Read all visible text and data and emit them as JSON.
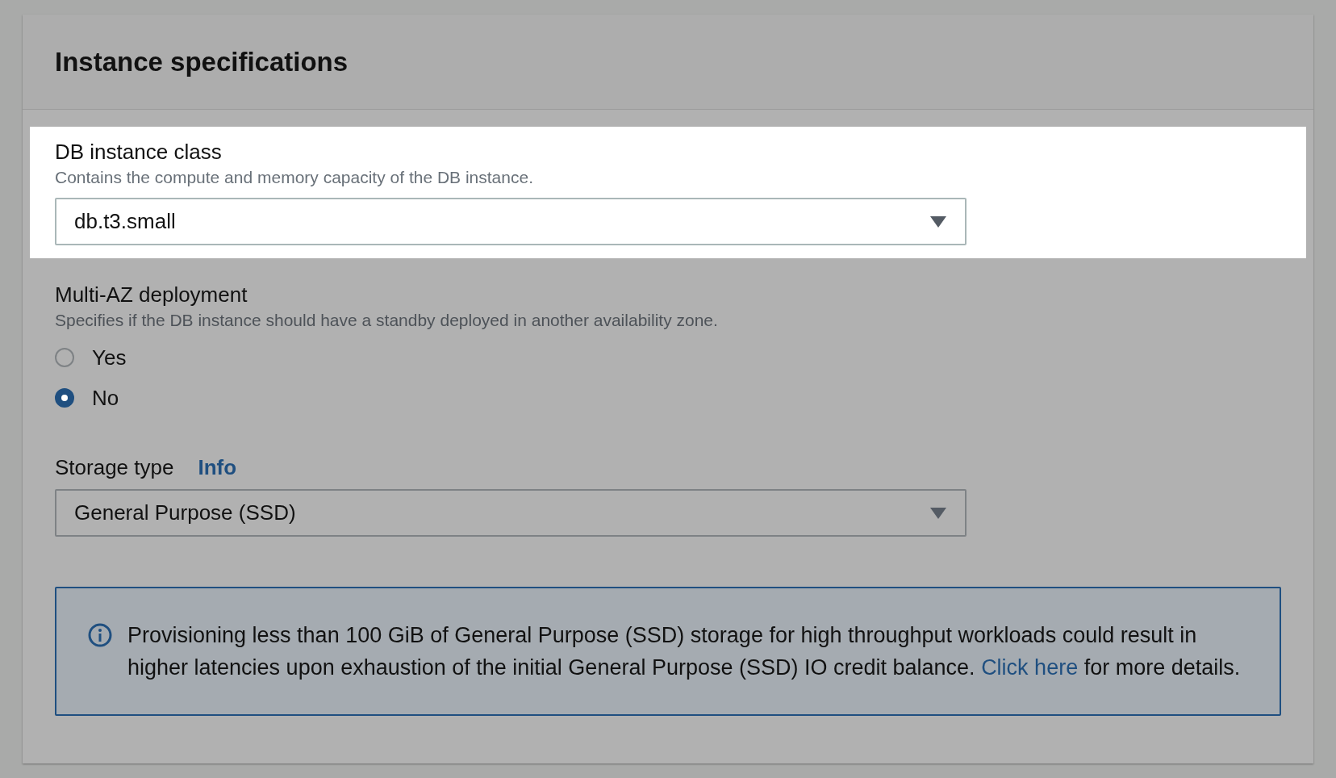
{
  "panel": {
    "title": "Instance specifications",
    "fields": [
      {
        "kind": "select",
        "label": "DB instance class",
        "description": "Contains the compute and memory capacity of the DB instance.",
        "value": "db.t3.small",
        "highlighted": true
      },
      {
        "kind": "radio",
        "label": "Multi-AZ deployment",
        "description": "Specifies if the DB instance should have a standby deployed in another availability zone.",
        "highlighted": false,
        "options": [
          {
            "label": "Yes",
            "selected": false
          },
          {
            "label": "No",
            "selected": true
          }
        ]
      },
      {
        "kind": "select",
        "label": "Storage type",
        "info": "Info",
        "value": "General Purpose (SSD)",
        "highlighted": false
      }
    ],
    "alert": {
      "text": "Provisioning less than 100 GiB of General Purpose (SSD) storage for high throughput workloads could result in higher latencies upon exhaustion of the initial General Purpose (SSD) IO credit balance.",
      "link": "Click here",
      "text_after": "for more details."
    }
  }
}
